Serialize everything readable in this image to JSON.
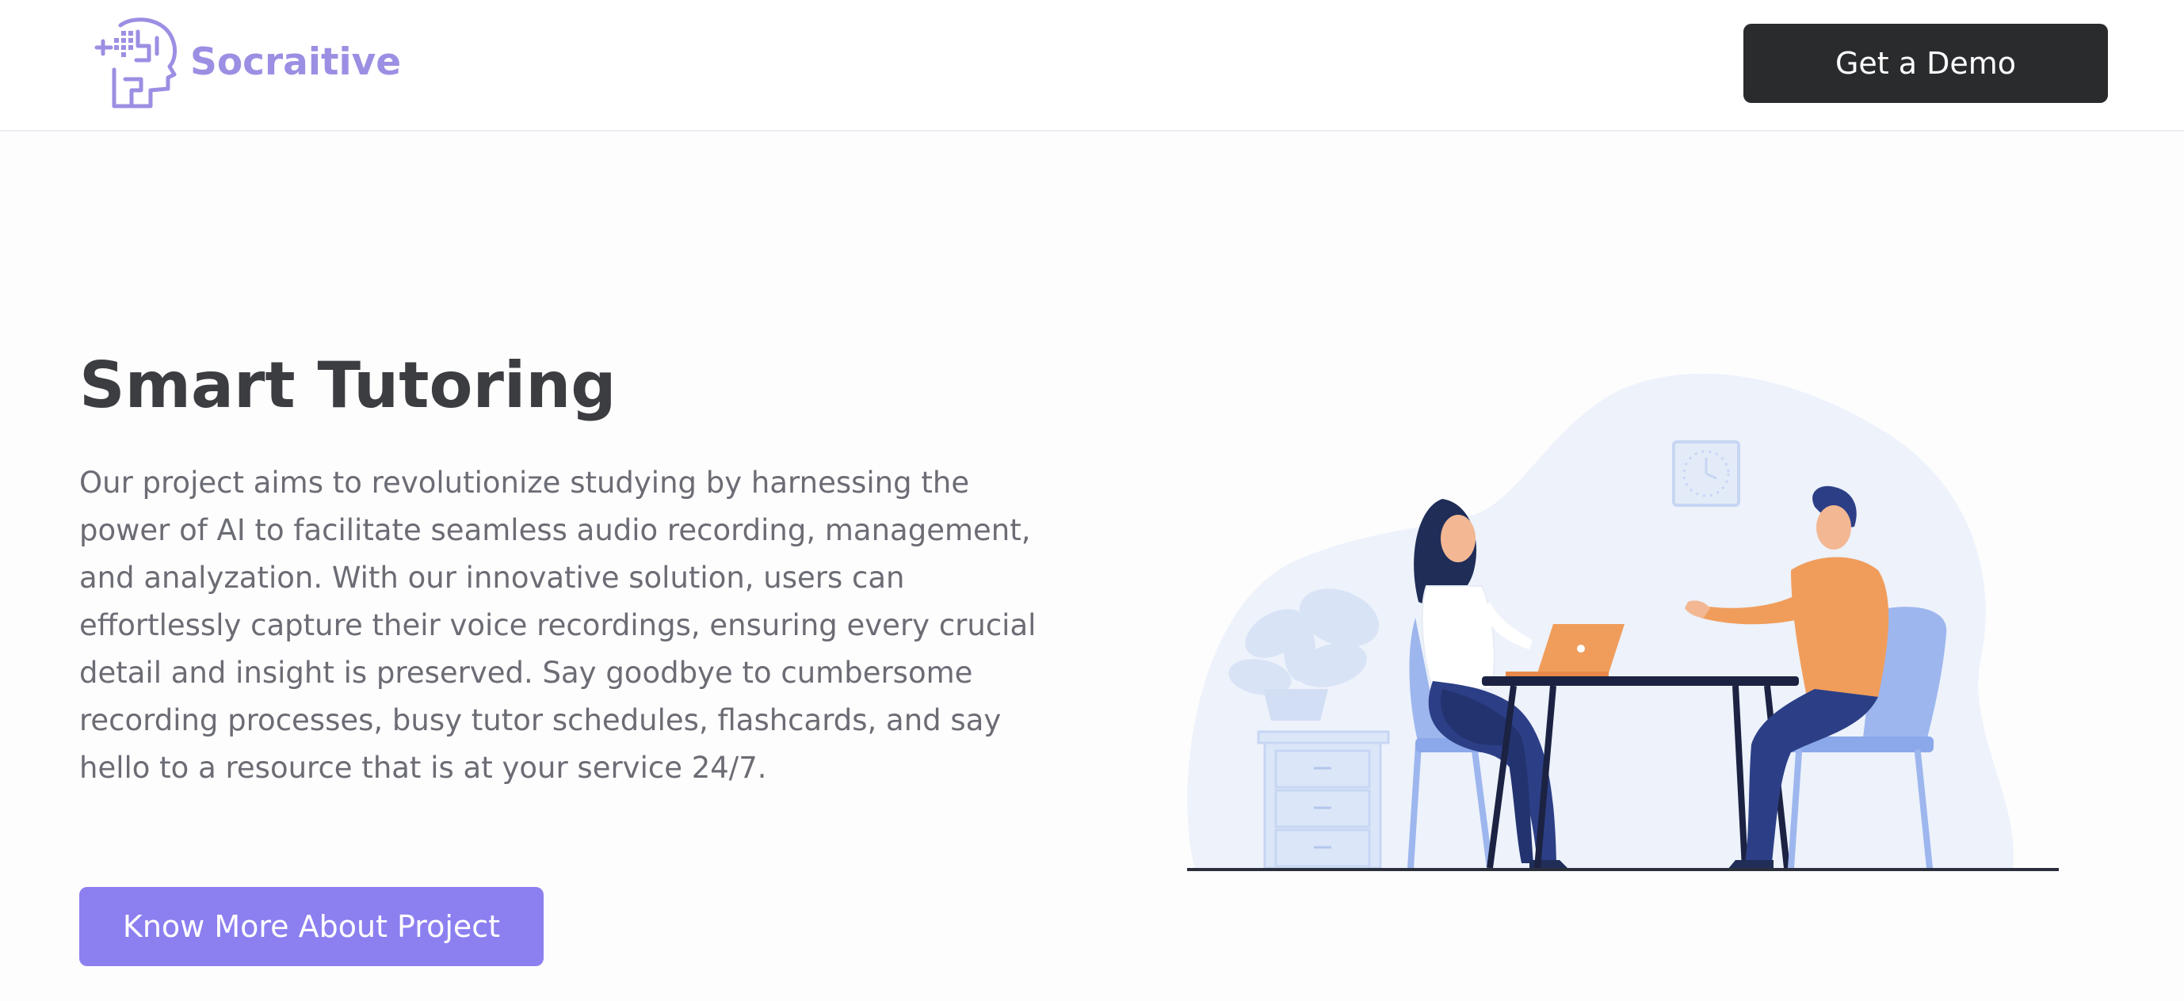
{
  "header": {
    "brand_name": "Socraitive",
    "logo_icon": "head-circuit-icon",
    "demo_button_label": "Get a Demo"
  },
  "hero": {
    "title": "Smart Tutoring",
    "description": "Our project aims to revolutionize studying by harnessing the power of AI to facilitate seamless audio recording, management, and analyzation. With our innovative solution, users can effortlessly capture their voice recordings, ensuring every crucial detail and insight is preserved. Say goodbye to cumbersome recording processes, busy tutor schedules, flashcards, and say hello to a resource that is at your service 24/7.",
    "cta_label": "Know More About Project",
    "illustration": "tutoring-session-illustration"
  },
  "colors": {
    "brand": "#9b8fe3",
    "cta": "#8c7ff0",
    "dark_button": "#2a2b2d",
    "heading": "#3c3d41",
    "body_text": "#6b6c74"
  }
}
